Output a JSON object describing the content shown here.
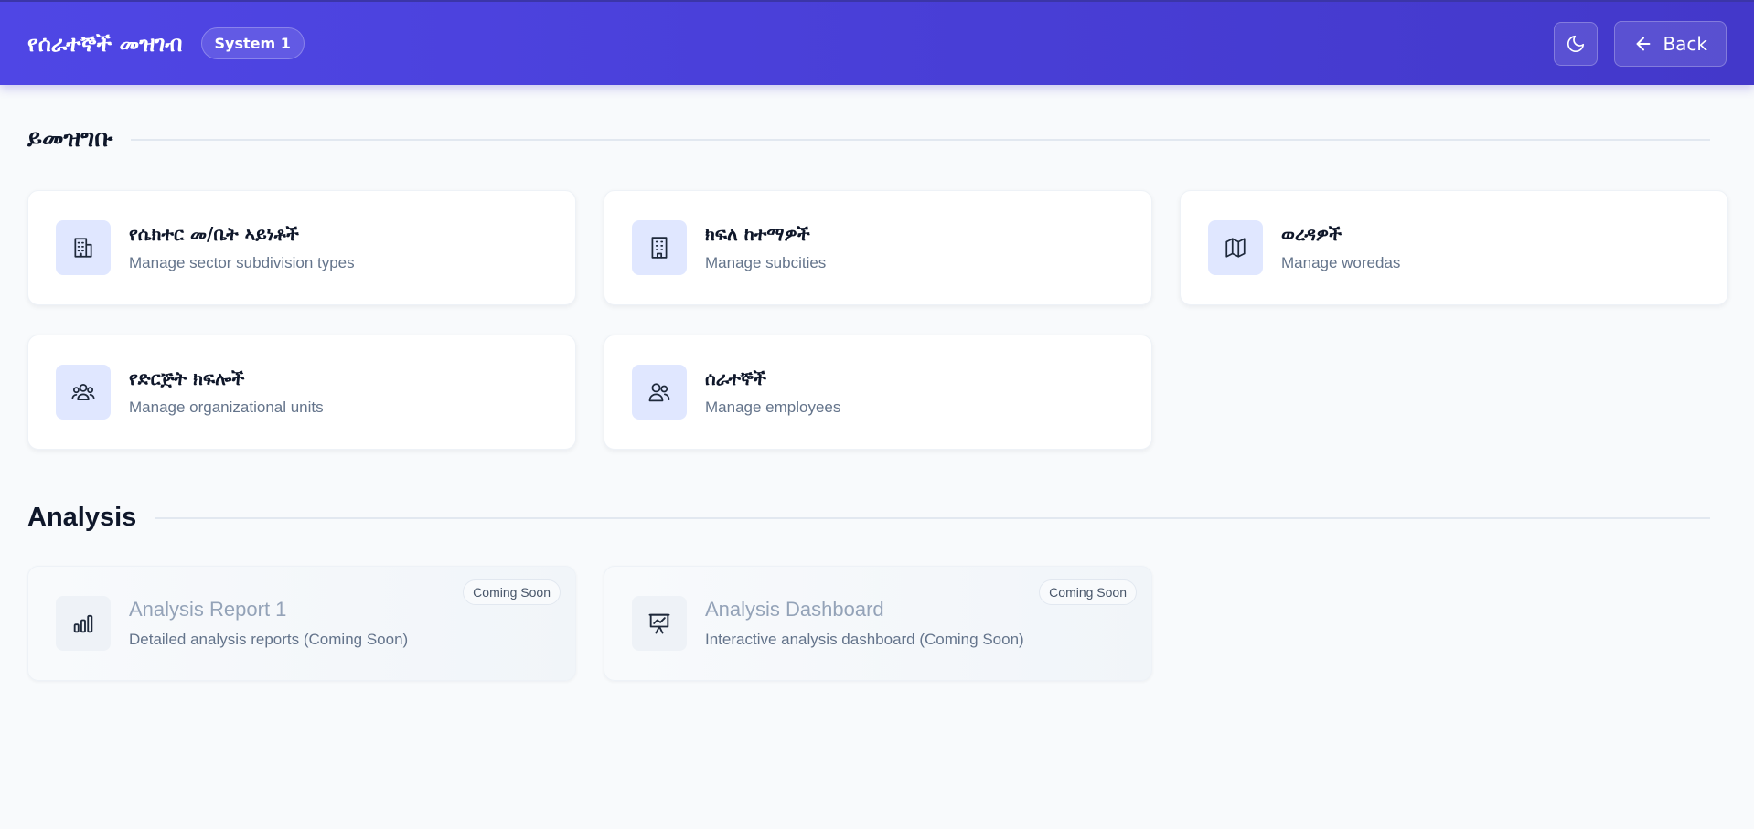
{
  "header": {
    "app_title": "የሰራተኞች መዝገብ",
    "system_badge": "System 1",
    "back_label": "Back"
  },
  "sections": {
    "registry": {
      "title": "ይመዝግቡ",
      "cards": [
        {
          "title": "የሴክተር መ/ቤት ኣይነቶች",
          "description": "Manage sector subdivision types",
          "icon": "building-icon"
        },
        {
          "title": "ክፍለ ከተማዎች",
          "description": "Manage subcities",
          "icon": "office-building-icon"
        },
        {
          "title": "ወረዳዎች",
          "description": "Manage woredas",
          "icon": "map-icon"
        },
        {
          "title": "የድርጅት ክፍሎች",
          "description": "Manage organizational units",
          "icon": "group-icon"
        },
        {
          "title": "ሰራተኞች",
          "description": "Manage employees",
          "icon": "users-icon"
        }
      ]
    },
    "analysis": {
      "title": "Analysis",
      "cards": [
        {
          "title": "Analysis Report 1",
          "description": "Detailed analysis reports (Coming Soon)",
          "badge": "Coming Soon",
          "icon": "bar-chart-icon"
        },
        {
          "title": "Analysis Dashboard",
          "description": "Interactive analysis dashboard (Coming Soon)",
          "badge": "Coming Soon",
          "icon": "presentation-chart-icon"
        }
      ]
    }
  },
  "colors": {
    "header_start": "#4f46e5",
    "header_end": "#4338ca",
    "icon_bg": "#e0e7ff",
    "page_bg": "#f8fafc"
  }
}
